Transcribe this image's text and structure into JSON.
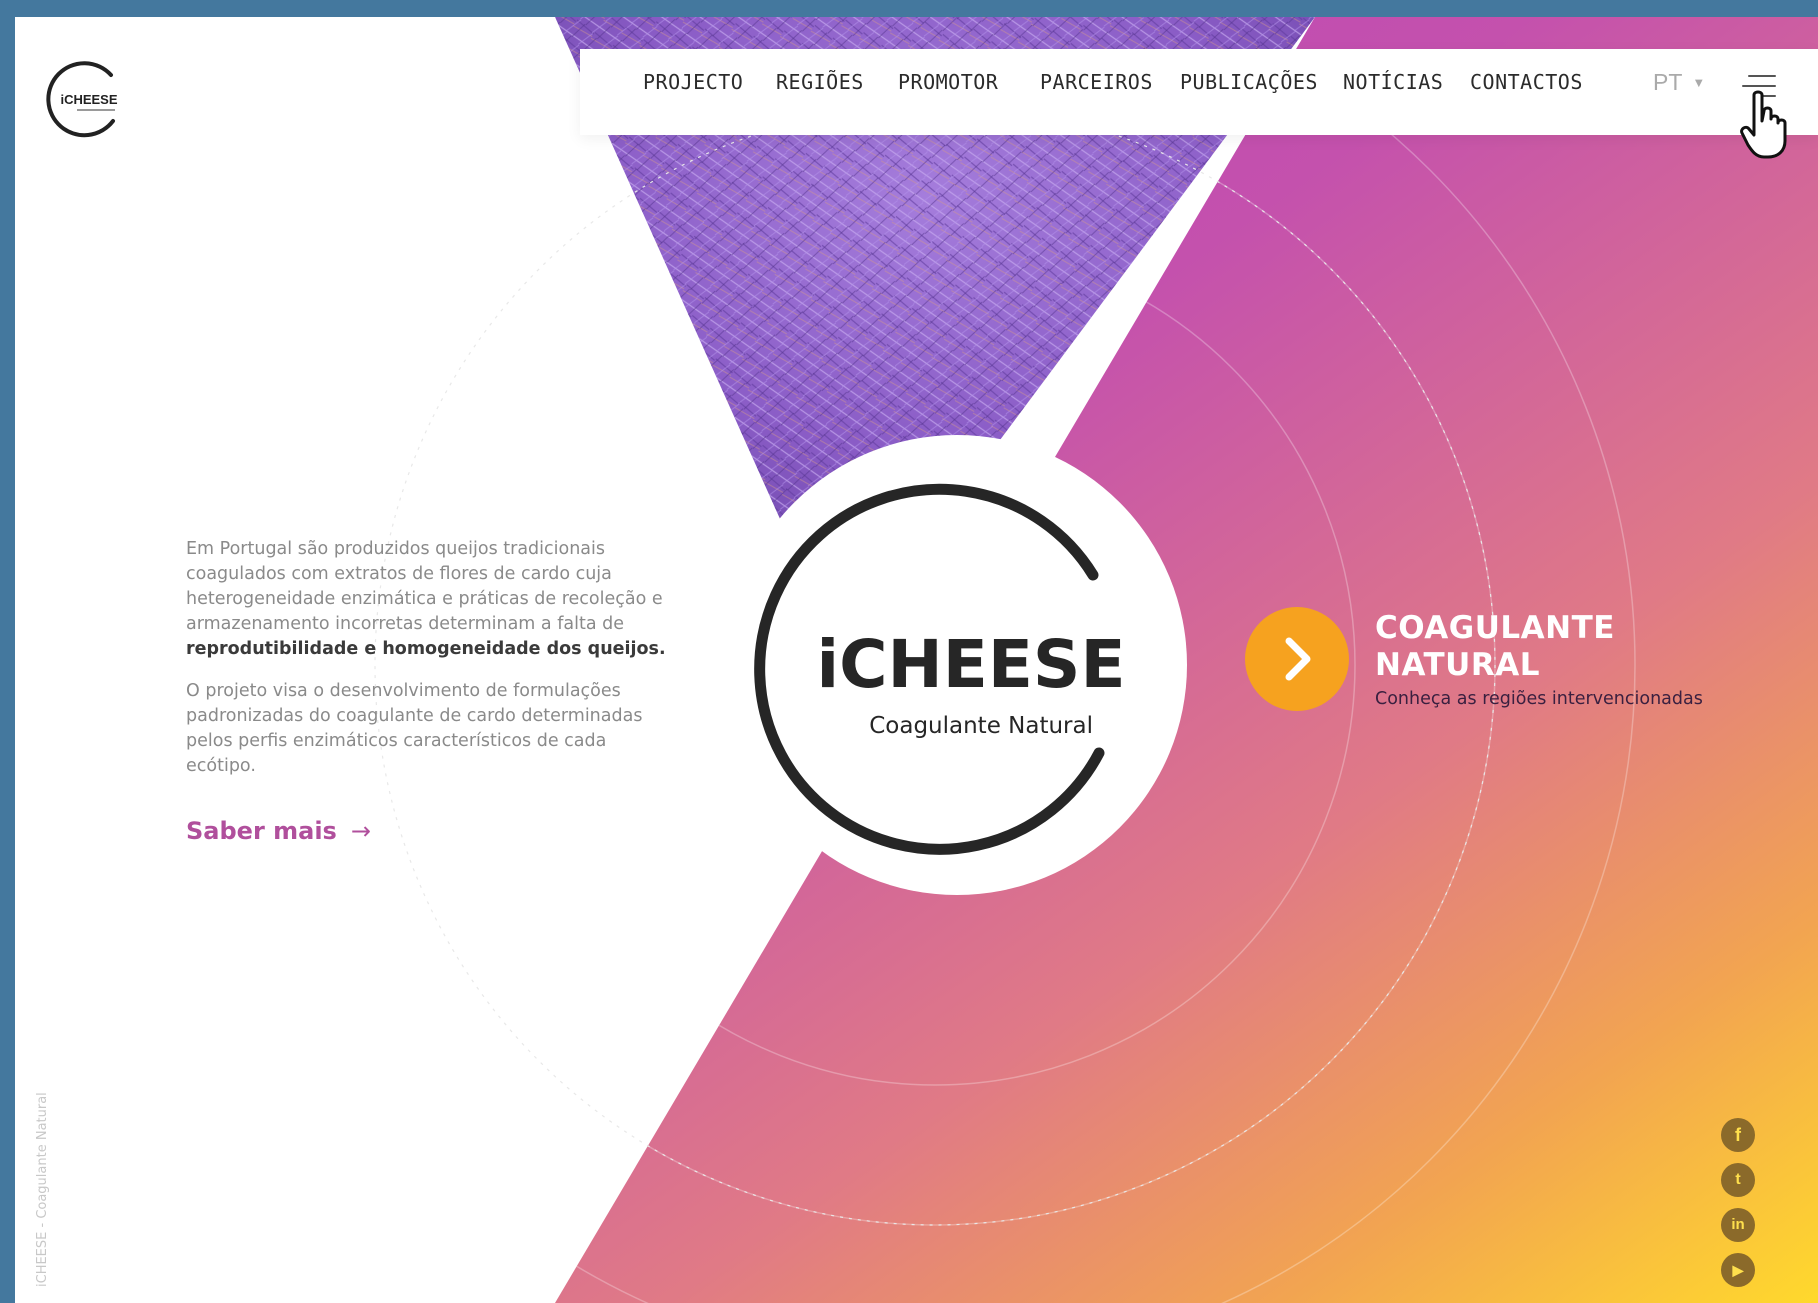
{
  "brand": {
    "name": "iCHEESE",
    "subtitle": "Coagulante Natural",
    "vertical_text": "iCHEESE - Coagulante Natural"
  },
  "nav": {
    "items": [
      {
        "label": "PROJECTO"
      },
      {
        "label": "REGIÕES"
      },
      {
        "label": "PROMOTOR"
      },
      {
        "label": "PARCEIROS"
      },
      {
        "label": "PUBLICAÇÕES"
      },
      {
        "label": "NOTÍCIAS"
      },
      {
        "label": "CONTACTOS"
      }
    ],
    "language": "PT"
  },
  "intro": {
    "paragraph1": "Em Portugal são produzidos queijos tradicionais coagulados com extratos de flores de cardo cuja heterogeneidade enzimática e práticas de recoleção e armazenamento incorretas determinam a falta de ",
    "paragraph1_bold": "reprodutibilidade e homogeneidade dos queijos.",
    "paragraph2": "O projeto visa o desenvolvimento de formulações padronizadas do coagulante de cardo determinadas pelos perfis enzimáticos característicos de cada ecótipo.",
    "link": "Saber mais",
    "link_arrow": "→"
  },
  "cta": {
    "title_line1": "COAGULANTE",
    "title_line2": "NATURAL",
    "subtitle": "Conheça as regiões intervencionadas",
    "button_icon": "chevron-right-icon",
    "color": "#f6a21f"
  },
  "social": [
    {
      "name": "facebook-icon",
      "glyph": "f"
    },
    {
      "name": "twitter-icon",
      "glyph": "t"
    },
    {
      "name": "linkedin-icon",
      "glyph": "in"
    },
    {
      "name": "youtube-icon",
      "glyph": "▶"
    }
  ],
  "colors": {
    "background_frame": "#44789e",
    "gradient_magenta": "#c04bb8",
    "gradient_orange": "#f0a050",
    "gradient_yellow": "#ffd62a",
    "link": "#b04f9c",
    "thistle": "#8a5fc8"
  }
}
